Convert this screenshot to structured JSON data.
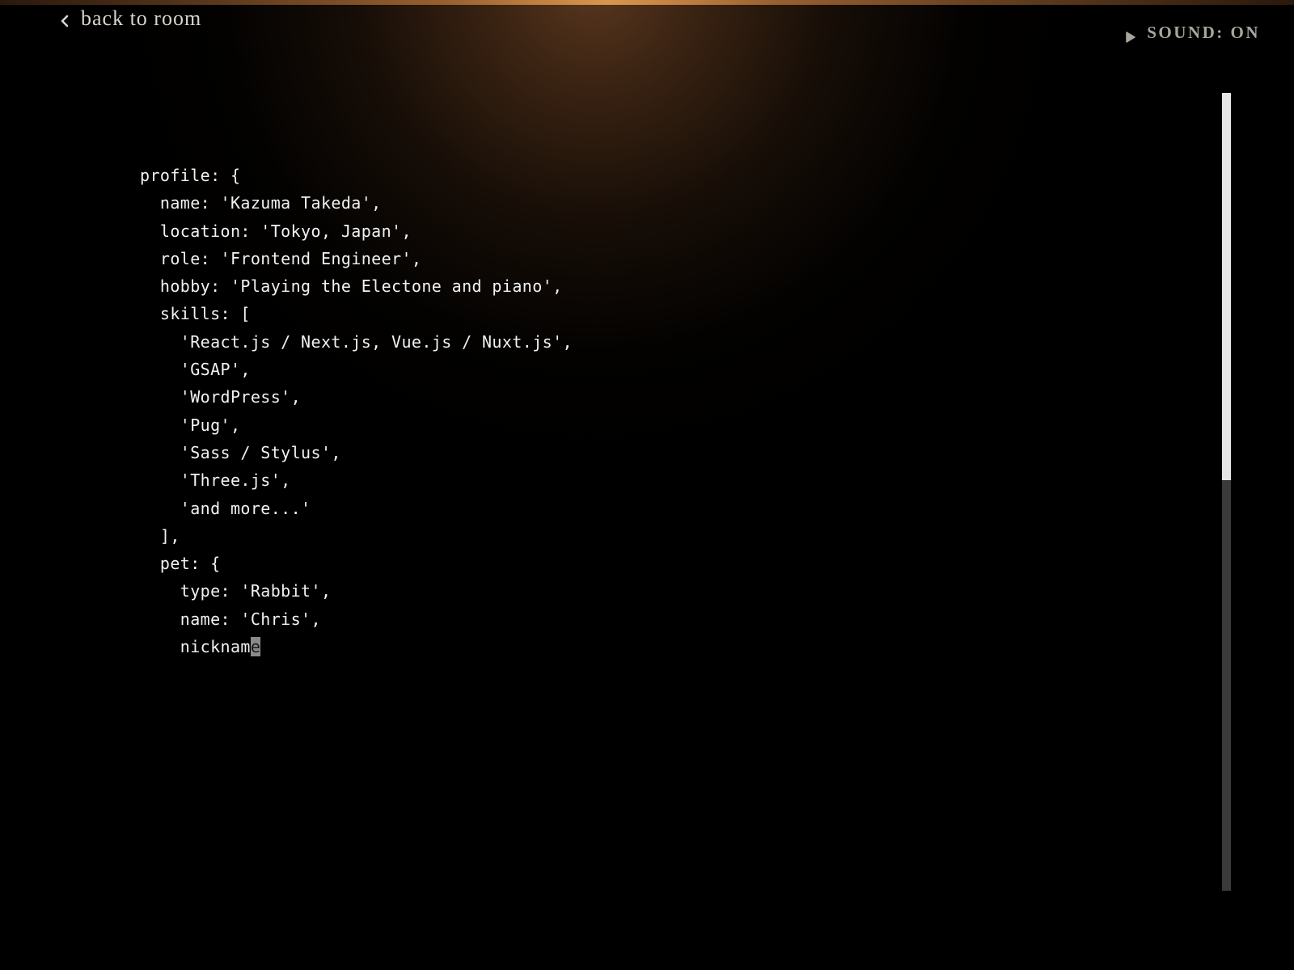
{
  "nav": {
    "back_label": "back to room",
    "back_icon": "chevron-left-icon"
  },
  "sound": {
    "label": "SOUND: ON",
    "icon": "play-icon"
  },
  "code": {
    "lines": [
      "profile: {",
      "  name: 'Kazuma Takeda',",
      "  location: 'Tokyo, Japan',",
      "  role: 'Frontend Engineer',",
      "  hobby: 'Playing the Electone and piano',",
      "  skills: [",
      "    'React.js / Next.js, Vue.js / Nuxt.js',",
      "    'GSAP',",
      "    'WordPress',",
      "    'Pug',",
      "    'Sass / Stylus',",
      "    'Three.js',",
      "    'and more...'",
      "  ],",
      "  pet: {",
      "    type: 'Rabbit',",
      "    name: 'Chris',"
    ],
    "typing_text": "    nicknam",
    "caret_char": "e"
  },
  "scrollbar": {
    "visible_fraction": 0.485,
    "scroll_position": 0
  }
}
